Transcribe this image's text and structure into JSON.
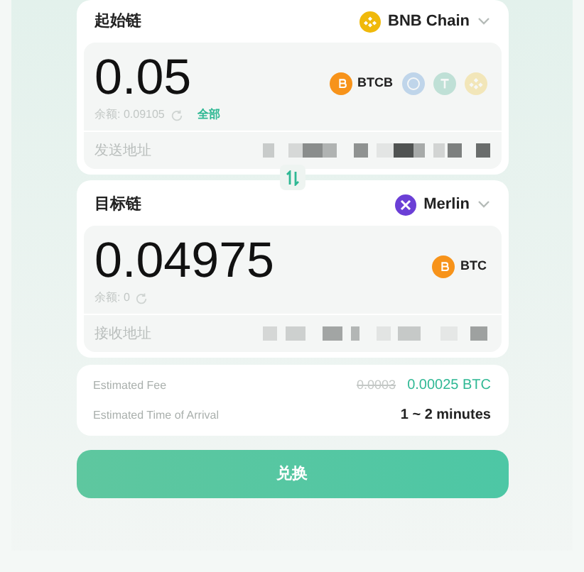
{
  "source": {
    "label": "起始链",
    "chain": {
      "kind": "bnb",
      "name": "BNB Chain"
    },
    "amount": "0.05",
    "balance": "余额: 0.09105",
    "max": "全部",
    "tokens": [
      {
        "kind": "btc",
        "symbol": "BTCB",
        "selected": true
      },
      {
        "kind": "usdc",
        "selected": false
      },
      {
        "kind": "usdt",
        "selected": false
      },
      {
        "kind": "bnb",
        "selected": false
      }
    ],
    "address_label": "发送地址"
  },
  "target": {
    "label": "目标链",
    "chain": {
      "kind": "merlin",
      "name": "Merlin"
    },
    "amount": "0.04975",
    "balance": "余额: 0",
    "tokens": [
      {
        "kind": "btc",
        "symbol": "BTC",
        "selected": true
      }
    ],
    "address_label": "接收地址"
  },
  "fee": {
    "label": "Estimated Fee",
    "old_value": "0.0003",
    "value": "0.00025 BTC"
  },
  "arrival": {
    "label": "Estimated Time of Arrival",
    "value": "1 ~ 2 minutes"
  },
  "button": "兑换"
}
